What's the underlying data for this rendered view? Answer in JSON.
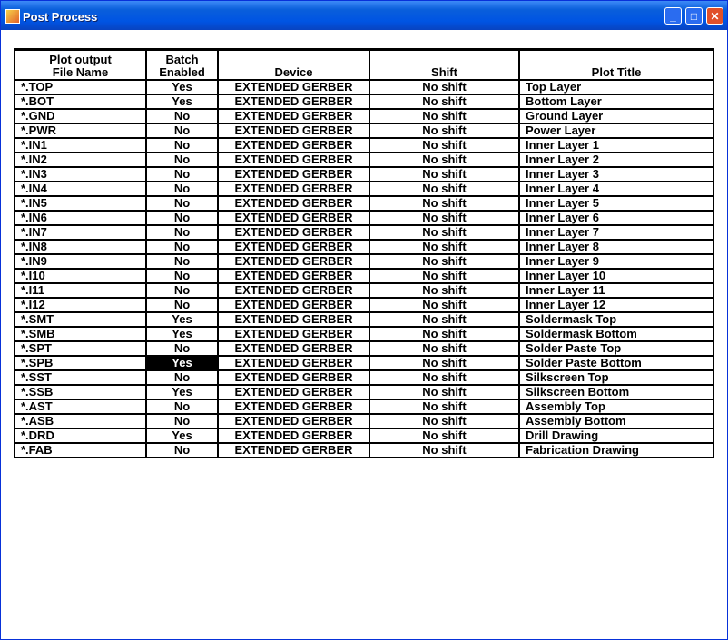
{
  "window": {
    "title": "Post Process"
  },
  "columns": [
    "Plot output\nFile Name",
    "Batch\nEnabled",
    "Device",
    "Shift",
    "Plot Title"
  ],
  "selected": {
    "row": 19,
    "col": 1
  },
  "rows": [
    [
      "*.TOP",
      "Yes",
      "EXTENDED GERBER",
      "No shift",
      "Top Layer"
    ],
    [
      "*.BOT",
      "Yes",
      "EXTENDED GERBER",
      "No shift",
      "Bottom Layer"
    ],
    [
      "*.GND",
      "No",
      "EXTENDED GERBER",
      "No shift",
      "Ground Layer"
    ],
    [
      "*.PWR",
      "No",
      "EXTENDED GERBER",
      "No shift",
      "Power Layer"
    ],
    [
      "*.IN1",
      "No",
      "EXTENDED GERBER",
      "No shift",
      "Inner Layer  1"
    ],
    [
      "*.IN2",
      "No",
      "EXTENDED GERBER",
      "No shift",
      "Inner Layer  2"
    ],
    [
      "*.IN3",
      "No",
      "EXTENDED GERBER",
      "No shift",
      "Inner Layer  3"
    ],
    [
      "*.IN4",
      "No",
      "EXTENDED GERBER",
      "No shift",
      "Inner Layer  4"
    ],
    [
      "*.IN5",
      "No",
      "EXTENDED GERBER",
      "No shift",
      "Inner Layer  5"
    ],
    [
      "*.IN6",
      "No",
      "EXTENDED GERBER",
      "No shift",
      "Inner Layer  6"
    ],
    [
      "*.IN7",
      "No",
      "EXTENDED GERBER",
      "No shift",
      "Inner Layer  7"
    ],
    [
      "*.IN8",
      "No",
      "EXTENDED GERBER",
      "No shift",
      "Inner Layer  8"
    ],
    [
      "*.IN9",
      "No",
      "EXTENDED GERBER",
      "No shift",
      "Inner Layer  9"
    ],
    [
      "*.I10",
      "No",
      "EXTENDED GERBER",
      "No shift",
      "Inner Layer 10"
    ],
    [
      "*.I11",
      "No",
      "EXTENDED GERBER",
      "No shift",
      "Inner Layer 11"
    ],
    [
      "*.I12",
      "No",
      "EXTENDED GERBER",
      "No shift",
      "Inner Layer 12"
    ],
    [
      "*.SMT",
      "Yes",
      "EXTENDED GERBER",
      "No shift",
      "Soldermask Top"
    ],
    [
      "*.SMB",
      "Yes",
      "EXTENDED GERBER",
      "No shift",
      "Soldermask Bottom"
    ],
    [
      "*.SPT",
      "No",
      "EXTENDED GERBER",
      "No shift",
      "Solder Paste Top"
    ],
    [
      "*.SPB",
      "Yes",
      "EXTENDED GERBER",
      "No shift",
      "Solder Paste Bottom"
    ],
    [
      "*.SST",
      "No",
      "EXTENDED GERBER",
      "No shift",
      "Silkscreen Top"
    ],
    [
      "*.SSB",
      "Yes",
      "EXTENDED GERBER",
      "No shift",
      "Silkscreen Bottom"
    ],
    [
      "*.AST",
      "No",
      "EXTENDED GERBER",
      "No shift",
      "Assembly Top"
    ],
    [
      "*.ASB",
      "No",
      "EXTENDED GERBER",
      "No shift",
      "Assembly Bottom"
    ],
    [
      "*.DRD",
      "Yes",
      "EXTENDED GERBER",
      "No shift",
      "Drill Drawing"
    ],
    [
      "*.FAB",
      "No",
      "EXTENDED GERBER",
      "No shift",
      "Fabrication Drawing"
    ]
  ]
}
